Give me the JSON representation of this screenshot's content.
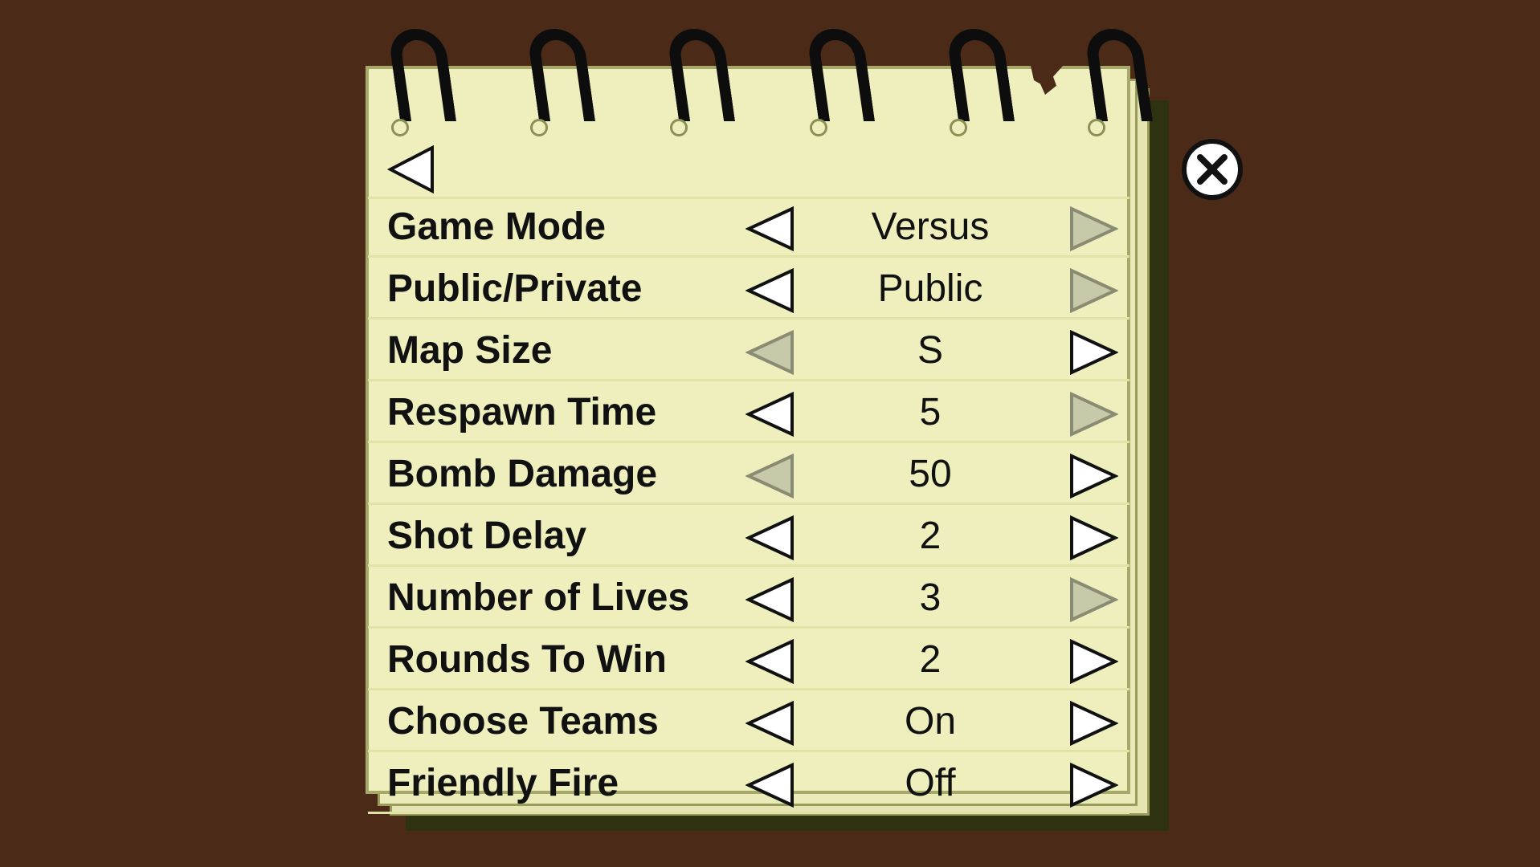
{
  "colors": {
    "background": "#4b2b17",
    "paper": "#efefbe",
    "paper_border": "#a7a96a",
    "arrow_active_fill": "#ffffff",
    "arrow_disabled_fill": "#c8c9a8",
    "text": "#111111"
  },
  "icons": {
    "back": "back-arrow-icon",
    "close": "close-x-icon",
    "decrease": "arrow-left-icon",
    "increase": "arrow-right-icon"
  },
  "settings": [
    {
      "label": "Game Mode",
      "value": "Versus",
      "left_enabled": true,
      "right_enabled": false
    },
    {
      "label": "Public/Private",
      "value": "Public",
      "left_enabled": true,
      "right_enabled": false
    },
    {
      "label": "Map Size",
      "value": "S",
      "left_enabled": false,
      "right_enabled": true
    },
    {
      "label": "Respawn Time",
      "value": "5",
      "left_enabled": true,
      "right_enabled": false
    },
    {
      "label": "Bomb Damage",
      "value": "50",
      "left_enabled": false,
      "right_enabled": true
    },
    {
      "label": "Shot Delay",
      "value": "2",
      "left_enabled": true,
      "right_enabled": true
    },
    {
      "label": "Number of Lives",
      "value": "3",
      "left_enabled": true,
      "right_enabled": false
    },
    {
      "label": "Rounds To Win",
      "value": "2",
      "left_enabled": true,
      "right_enabled": true
    },
    {
      "label": "Choose Teams",
      "value": "On",
      "left_enabled": true,
      "right_enabled": true
    },
    {
      "label": "Friendly Fire",
      "value": "Off",
      "left_enabled": true,
      "right_enabled": true
    }
  ]
}
